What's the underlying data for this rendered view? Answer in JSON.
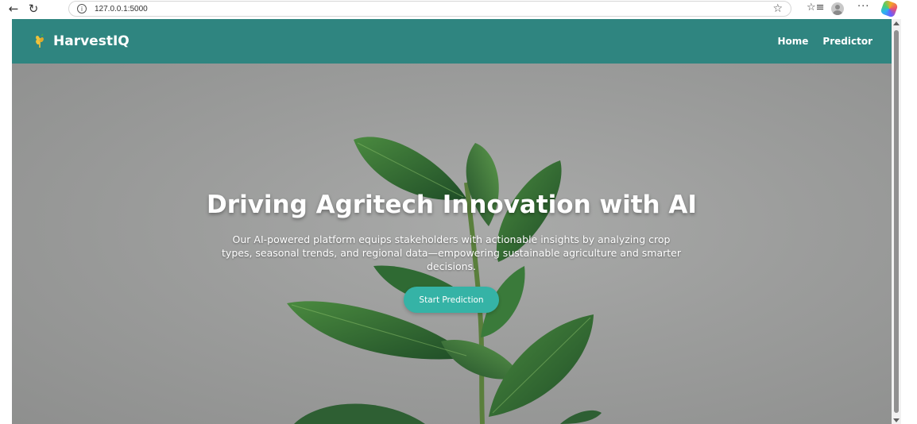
{
  "browser": {
    "url": "127.0.0.1:5000"
  },
  "nav": {
    "brand": "HarvestIQ",
    "links": [
      "Home",
      "Predictor"
    ]
  },
  "hero": {
    "title": "Driving Agritech Innovation with AI",
    "description": "Our AI-powered platform equips stakeholders with actionable insights by analyzing crop types, seasonal trends, and regional data—empowering sustainable agriculture and smarter decisions.",
    "cta_label": "Start Prediction"
  },
  "colors": {
    "nav_bg": "#2f8580",
    "cta_bg": "#35b3a6",
    "leaf": "#2e6a34"
  },
  "icons": {
    "logo": "wheat-icon",
    "back": "arrow-left-icon",
    "reload": "reload-icon",
    "info": "info-icon",
    "favorite": "star-icon",
    "favorites": "favorites-icon",
    "profile": "profile-icon",
    "more": "more-icon",
    "copilot": "copilot-icon"
  }
}
